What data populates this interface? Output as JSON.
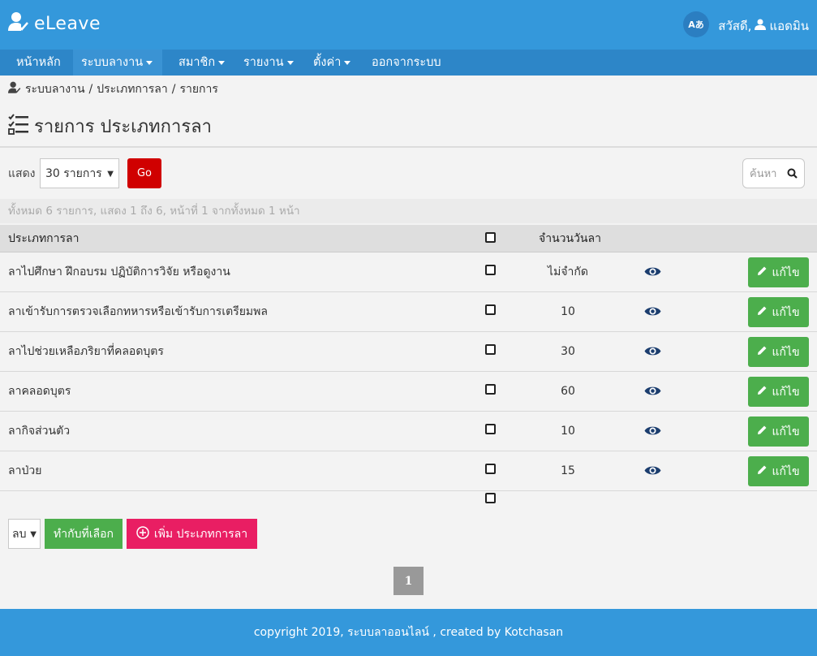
{
  "app": {
    "brand": "eLeave",
    "lang_label": "Aあ",
    "greeting": "สวัสดี,",
    "user_name": "แอดมิน"
  },
  "nav": {
    "items": [
      {
        "label": "หน้าหลัก",
        "dropdown": false
      },
      {
        "label": "ระบบลางาน",
        "dropdown": true,
        "active": true
      },
      {
        "label": "สมาชิก",
        "dropdown": true
      },
      {
        "label": "รายงาน",
        "dropdown": true
      },
      {
        "label": "ตั้งค่า",
        "dropdown": true
      },
      {
        "label": "ออกจากระบบ",
        "dropdown": false
      }
    ]
  },
  "breadcrumb": [
    "ระบบลางาน",
    "ประเภทการลา",
    "รายการ"
  ],
  "breadcrumb_sep": "/",
  "page_title": "รายการ ประเภทการลา",
  "filter": {
    "show_label": "แสดง",
    "show_value": "30 รายการ",
    "go_label": "Go",
    "search_placeholder": "ค้นหา"
  },
  "summary": "ทั้งหมด 6 รายการ, แสดง 1 ถึง 6, หน้าที่ 1 จากทั้งหมด 1 หน้า",
  "table": {
    "headers": {
      "type": "ประเภทการลา",
      "days": "จำนวนวันลา"
    },
    "edit_label": "แก้ไข",
    "rows": [
      {
        "type": "ลาไปศึกษา ฝึกอบรม ปฏิบัติการวิจัย หรือดูงาน",
        "days": "ไม่จำกัด"
      },
      {
        "type": "ลาเข้ารับการตรวจเลือกทหารหรือเข้ารับการเตรียมพล",
        "days": "10"
      },
      {
        "type": "ลาไปช่วยเหลือภริยาที่คลอดบุตร",
        "days": "30"
      },
      {
        "type": "ลาคลอดบุตร",
        "days": "60"
      },
      {
        "type": "ลากิจส่วนตัว",
        "days": "10"
      },
      {
        "type": "ลาป่วย",
        "days": "15"
      }
    ]
  },
  "actions": {
    "action_value": "ลบ",
    "apply_label": "ทำกับที่เลือก",
    "add_label": "เพิ่ม ประเภทการลา"
  },
  "pagination": {
    "current": "1"
  },
  "footer": "copyright 2019, ระบบลาออนไลน์ , created by Kotchasan",
  "colors": {
    "header": "#3498db",
    "nav": "#2d86c8",
    "go_button": "#d00000",
    "edit_button": "#4cae4c",
    "add_button": "#e91e63",
    "eye_icon": "#1b3d6e"
  }
}
